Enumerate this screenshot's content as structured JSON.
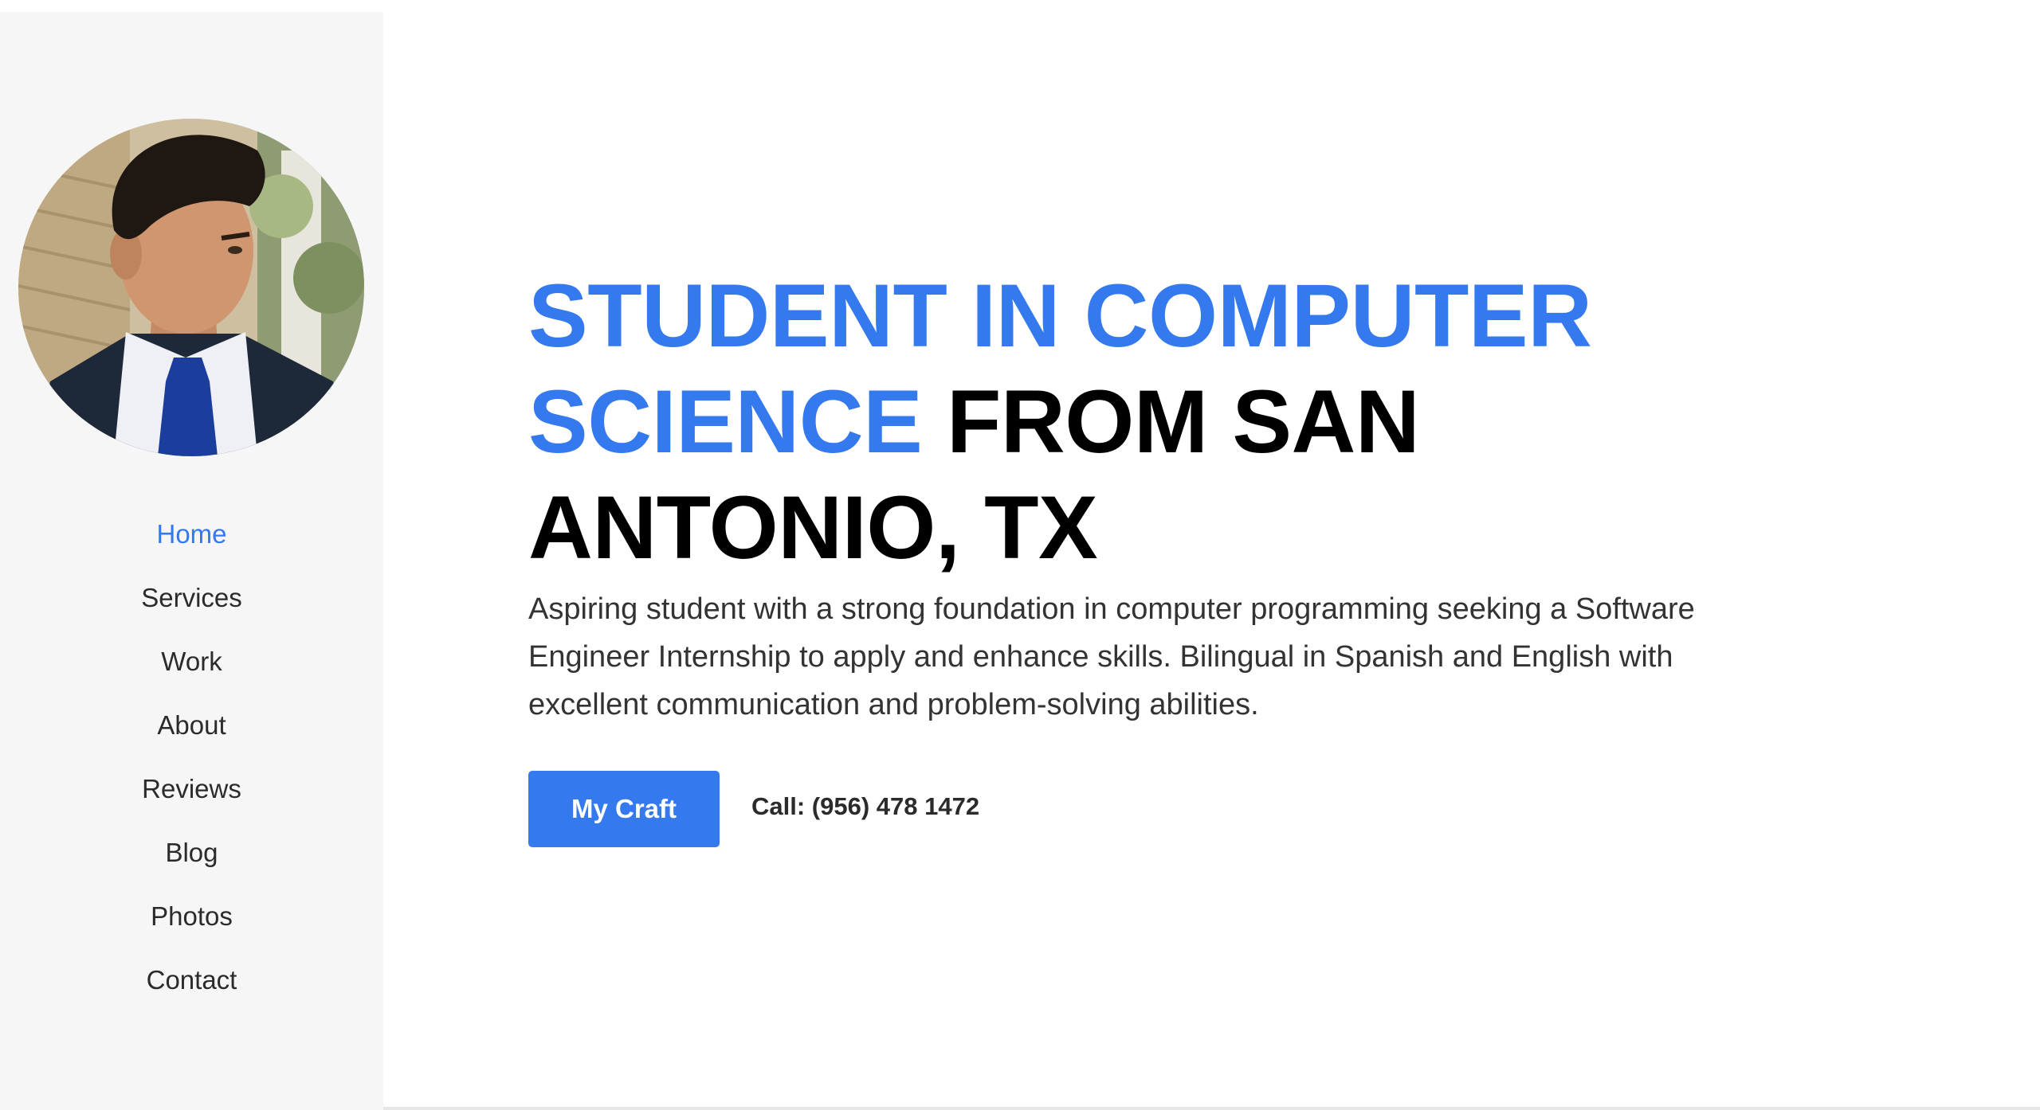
{
  "profile": {
    "photo_label": "Portrait photo"
  },
  "nav": {
    "items": [
      {
        "label": "Home",
        "active": true
      },
      {
        "label": "Services",
        "active": false
      },
      {
        "label": "Work",
        "active": false
      },
      {
        "label": "About",
        "active": false
      },
      {
        "label": "Reviews",
        "active": false
      },
      {
        "label": "Blog",
        "active": false
      },
      {
        "label": "Photos",
        "active": false
      },
      {
        "label": "Contact",
        "active": false
      }
    ]
  },
  "hero": {
    "headline_accent": "STUDENT IN COMPUTER SCIENCE",
    "headline_rest": "FROM SAN ANTONIO, TX",
    "description": "Aspiring student with a strong foundation in computer programming seeking a Software Engineer Internship to apply and enhance skills. Bilingual in Spanish and English with excellent communication and problem-solving abilities.",
    "cta_label": "My Craft",
    "phone": "Call: (956) 478 1472"
  },
  "colors": {
    "accent": "#3479ee",
    "sidebar_bg": "#f6f6f6",
    "text_dark": "#000000"
  }
}
